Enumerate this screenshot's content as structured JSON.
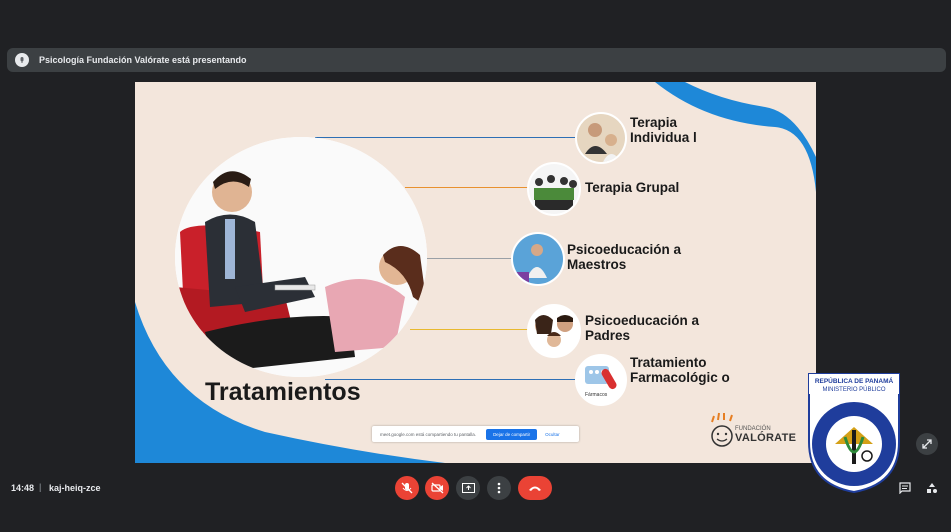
{
  "banner": {
    "text": "Psicología Fundación Valórate está presentando"
  },
  "slide": {
    "title": "Tratamientos",
    "items": [
      {
        "label": "Terapia Individua l"
      },
      {
        "label": "Terapia Grupal"
      },
      {
        "label": "Psicoeducación a Maestros"
      },
      {
        "label": "Psicoeducación a Padres"
      },
      {
        "label": "Tratamiento Farmacológic o"
      }
    ],
    "thumb5_text": "Fármacos",
    "share_bar": {
      "text": "meet.google.com está compartiendo tu pantalla.",
      "stop_label": "Dejar de compartir",
      "hide_label": "Ocultar"
    },
    "logo": {
      "top": "FUNDACIÓN",
      "name": "VALÓRATE"
    }
  },
  "seal": {
    "line1": "REPÚBLICA DE PANAMÁ",
    "line2": "MINISTERIO PÚBLICO",
    "ring_text": "INSTITUTO DE MEDICINA LEGAL Y CIENCIAS FORENSES"
  },
  "bottom": {
    "time": "14:48",
    "separator": "|",
    "meeting_code": "kaj-heiq-zce"
  },
  "colors": {
    "accent_blue": "#1e88d8",
    "end_call": "#ea4335",
    "background": "#202124"
  }
}
